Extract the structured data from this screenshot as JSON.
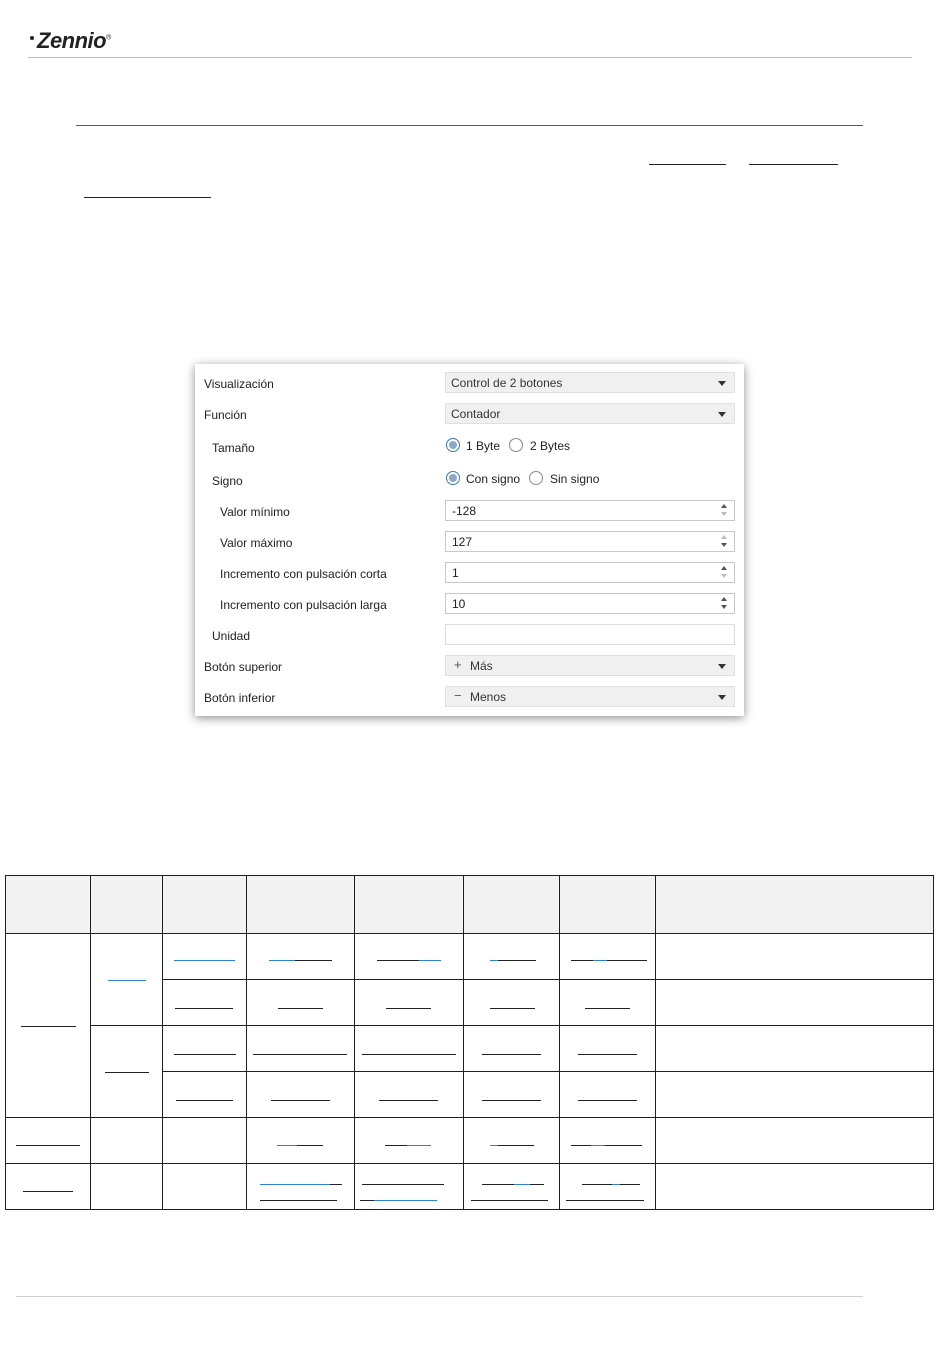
{
  "header": {
    "logo_text": "Zennio",
    "logo_mark": "®"
  },
  "panel": {
    "rows": {
      "visualizacion": {
        "label": "Visualización",
        "value": "Control de 2 botones"
      },
      "funcion": {
        "label": "Función",
        "value": "Contador"
      },
      "tamano": {
        "label": "Tamaño",
        "opt1": "1 Byte",
        "opt2": "2 Bytes",
        "selected": "1 Byte"
      },
      "signo": {
        "label": "Signo",
        "opt1": "Con signo",
        "opt2": "Sin signo",
        "selected": "Con signo"
      },
      "valor_minimo": {
        "label": "Valor mínimo",
        "value": "-128"
      },
      "valor_maximo": {
        "label": "Valor máximo",
        "value": "127"
      },
      "inc_corta": {
        "label": "Incremento con pulsación corta",
        "value": "1"
      },
      "inc_larga": {
        "label": "Incremento con pulsación larga",
        "value": "10"
      },
      "unidad": {
        "label": "Unidad",
        "value": ""
      },
      "boton_superior": {
        "label": "Botón superior",
        "icon": "+",
        "value": "Más"
      },
      "boton_inferior": {
        "label": "Botón inferior",
        "icon": "−",
        "value": "Menos"
      }
    }
  },
  "colors": {
    "link": "#2f7fd2",
    "radio_selected": "#3a78c3",
    "table_header": "#f2f2f2"
  }
}
